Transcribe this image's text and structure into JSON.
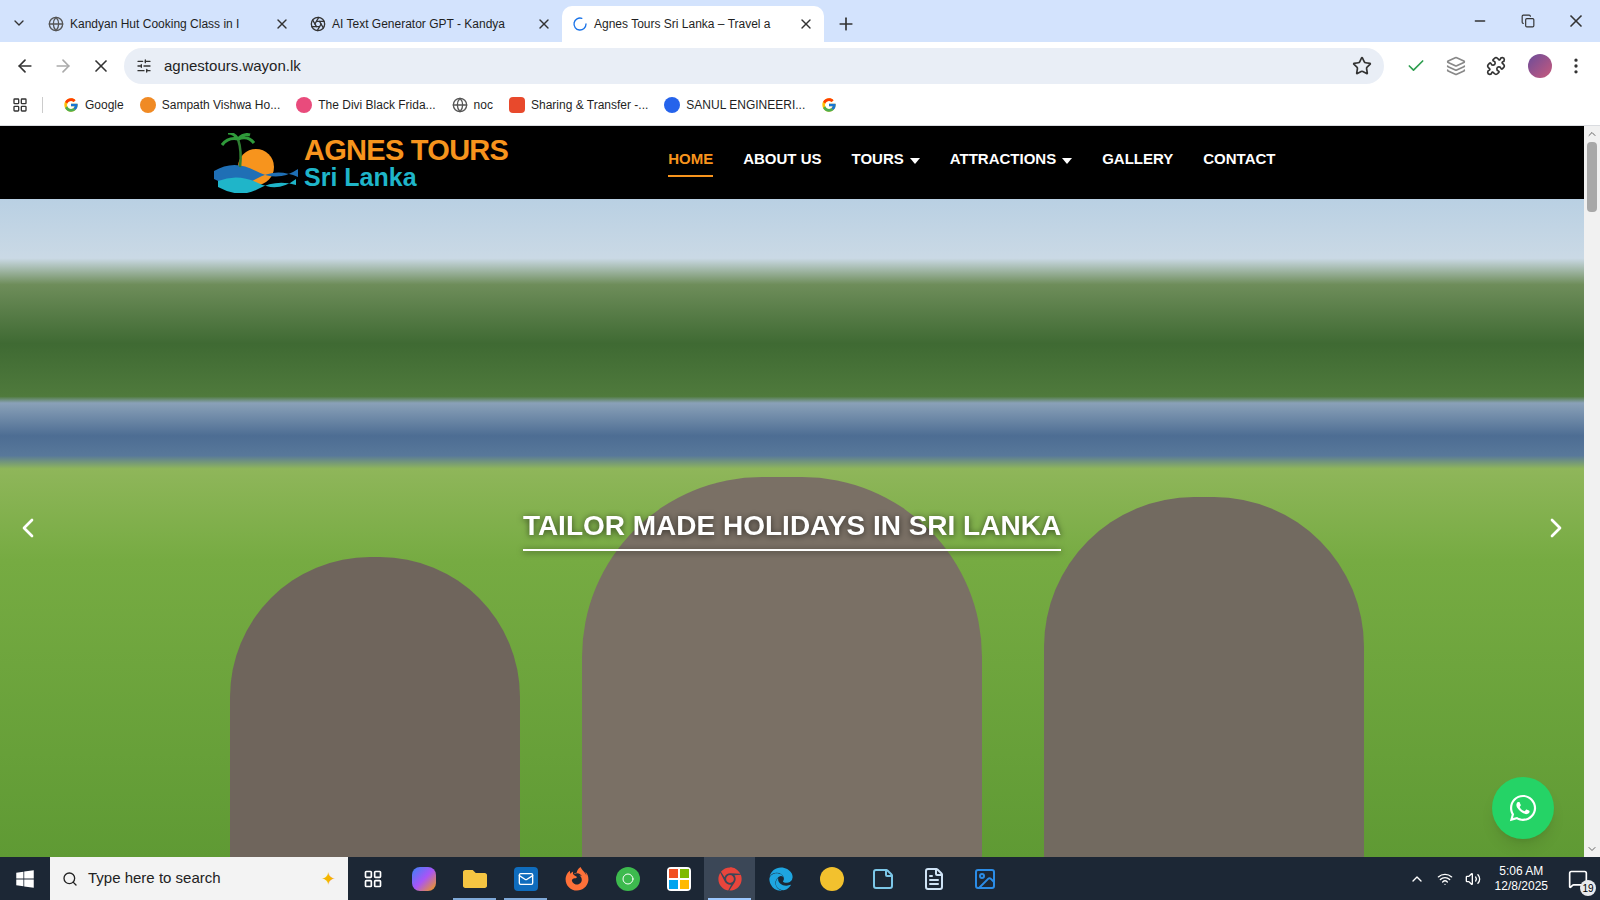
{
  "browser": {
    "tabs": [
      {
        "label": "Kandyan Hut Cooking Class in I",
        "selected": false,
        "kind": "globe"
      },
      {
        "label": "AI Text Generator GPT - Kandya",
        "selected": false,
        "kind": "gpt"
      },
      {
        "label": "Agnes Tours Sri Lanka – Travel a",
        "selected": true,
        "kind": "loading"
      }
    ],
    "address": "agnestours.wayon.lk",
    "loading": true,
    "bookmarks": [
      {
        "label": "Google",
        "kind": "google"
      },
      {
        "label": "Sampath Vishwa Ho...",
        "kind": "sampath"
      },
      {
        "label": "The Divi Black Frida...",
        "kind": "divi"
      },
      {
        "label": "noc",
        "kind": "noc"
      },
      {
        "label": "Sharing & Transfer -...",
        "kind": "sharing"
      },
      {
        "label": "SANUL ENGINEERI...",
        "kind": "sanul"
      },
      {
        "kind": "google"
      }
    ],
    "scrollbar": {
      "level": 0.1
    }
  },
  "site": {
    "logo": {
      "line1": "AGNES TOURS",
      "line2": "Sri Lanka"
    },
    "nav": [
      {
        "label": "HOME",
        "selected": true,
        "dropdown": false
      },
      {
        "label": "ABOUT US",
        "selected": false,
        "dropdown": false
      },
      {
        "label": "TOURS",
        "selected": false,
        "dropdown": true
      },
      {
        "label": "ATTRACTIONS",
        "selected": false,
        "dropdown": true
      },
      {
        "label": "GALLERY",
        "selected": false,
        "dropdown": false
      },
      {
        "label": "CONTACT",
        "selected": false,
        "dropdown": false
      }
    ],
    "hero": {
      "caption": "TAILOR MADE HOLIDAYS IN SRI LANKA"
    }
  },
  "taskbar": {
    "search": {
      "placeholder": "Type here to search"
    },
    "apps": [
      {
        "kind": "copilot",
        "running": false,
        "selected": false
      },
      {
        "kind": "explorer",
        "running": true,
        "selected": false
      },
      {
        "kind": "outlook",
        "running": true,
        "selected": false
      },
      {
        "kind": "firefox",
        "running": false,
        "selected": false
      },
      {
        "kind": "green",
        "running": false,
        "selected": false
      },
      {
        "kind": "store",
        "running": false,
        "selected": false
      },
      {
        "kind": "chrome",
        "running": true,
        "selected": true
      },
      {
        "kind": "edge",
        "running": false,
        "selected": false
      },
      {
        "kind": "yellow",
        "running": false,
        "selected": false
      },
      {
        "kind": "notes",
        "running": false,
        "selected": false
      },
      {
        "kind": "document",
        "running": false,
        "selected": false
      },
      {
        "kind": "photos",
        "running": false,
        "selected": false
      }
    ],
    "time": "5:06 AM",
    "date": "12/8/2025",
    "notifications": "19"
  }
}
